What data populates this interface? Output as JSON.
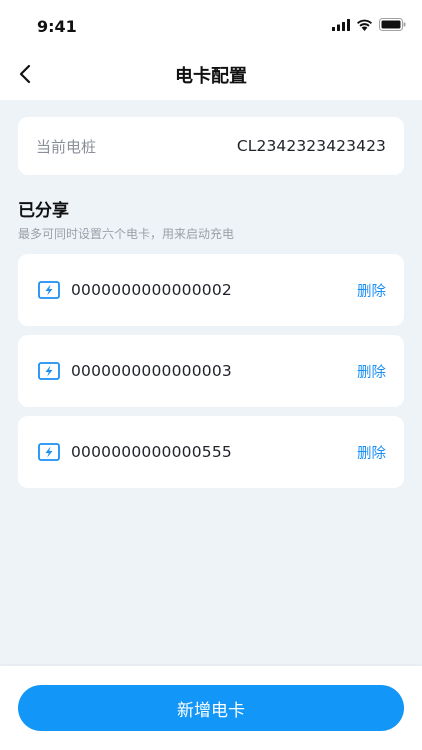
{
  "status_bar": {
    "time": "9:41"
  },
  "nav": {
    "title": "电卡配置"
  },
  "pile": {
    "label": "当前电桩",
    "value": "CL2342323423423"
  },
  "section": {
    "title": "已分享",
    "subtitle": "最多可同时设置六个电卡，用来启动充电"
  },
  "cards": [
    {
      "number": "0000000000000002",
      "delete_label": "删除"
    },
    {
      "number": "0000000000000003",
      "delete_label": "删除"
    },
    {
      "number": "0000000000000555",
      "delete_label": "删除"
    }
  ],
  "footer": {
    "add_label": "新增电卡"
  },
  "colors": {
    "accent": "#1296f7",
    "link": "#1a8ff5",
    "background": "#eef3f8"
  },
  "icons": {
    "card": "electric-card-icon",
    "back": "chevron-left-icon"
  }
}
